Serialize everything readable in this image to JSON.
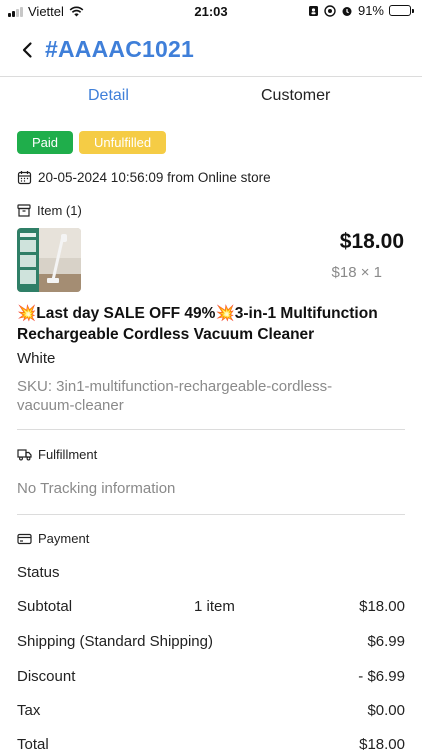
{
  "status_bar": {
    "carrier": "Viettel",
    "time": "21:03",
    "battery": "91%",
    "battery_level": 0.91
  },
  "header": {
    "title": "#AAAAC1021"
  },
  "tabs": [
    {
      "label": "Detail",
      "active": true
    },
    {
      "label": "Customer",
      "active": false
    }
  ],
  "badges": {
    "paid": "Paid",
    "unfulfilled": "Unfulfilled"
  },
  "order": {
    "datetime": "20-05-2024 10:56:09 from Online store"
  },
  "item_section": {
    "heading": "Item (1)",
    "price": "$18.00",
    "unit_price_qty": "$18 × 1",
    "title": "💥Last day SALE OFF 49%💥3-in-1 Multifunction Rechargeable Cordless Vacuum Cleaner",
    "variant": "White",
    "sku": "SKU: 3in1-multifunction-rechargeable-cordless-vacuum-cleaner"
  },
  "fulfillment": {
    "heading": "Fulfillment",
    "tracking": "No Tracking information"
  },
  "payment": {
    "heading": "Payment",
    "status_label": "Status",
    "rows": [
      {
        "label": "Subtotal",
        "mid": "1 item",
        "value": "$18.00"
      },
      {
        "label": "Shipping (Standard Shipping)",
        "mid": "",
        "value": "$6.99"
      },
      {
        "label": "Discount",
        "mid": "",
        "value": "- $6.99"
      },
      {
        "label": "Tax",
        "mid": "",
        "value": "$0.00"
      },
      {
        "label": "Total",
        "mid": "",
        "value": "$18.00"
      }
    ]
  },
  "colors": {
    "accent": "#3f7fd9",
    "paid": "#1fae4b",
    "unfulfilled": "#f5cc45"
  },
  "icons": {
    "back": "chevron-left-icon",
    "calendar": "calendar-icon",
    "item": "archive-box-icon",
    "fulfillment": "truck-icon",
    "payment": "credit-card-icon"
  }
}
